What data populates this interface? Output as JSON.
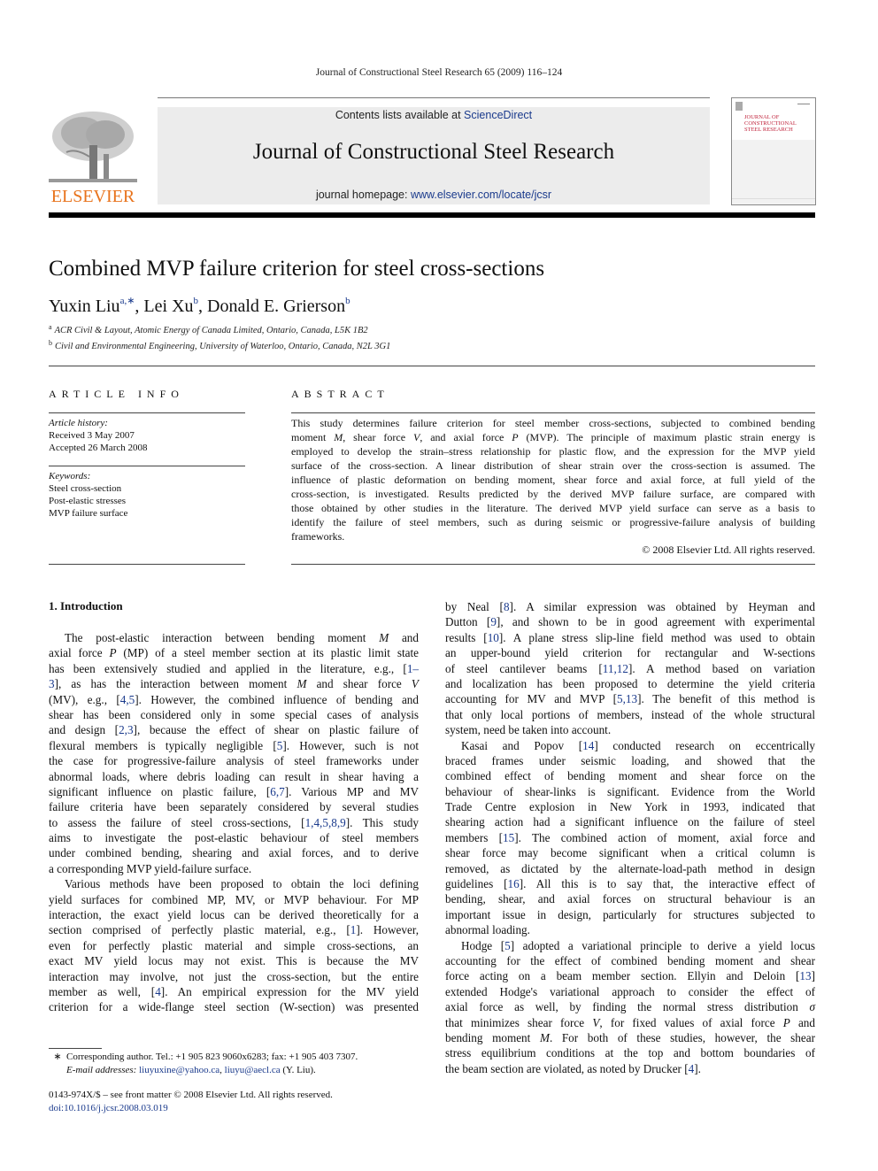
{
  "running_head": "Journal of Constructional Steel Research 65 (2009) 116–124",
  "banner": {
    "contents_prefix": "Contents lists available at ",
    "contents_link": "ScienceDirect",
    "journal_title": "Journal of Constructional Steel Research",
    "homepage_prefix": "journal homepage: ",
    "homepage_link": "www.elsevier.com/locate/jcsr"
  },
  "publisher_logo": "ELSEVIER",
  "cover": {
    "title_lines": [
      "JOURNAL OF",
      "CONSTRUCTIONAL",
      "STEEL RESEARCH"
    ]
  },
  "colors": {
    "link": "#1a3a8c",
    "elsevier_orange": "#e8731c",
    "cover_red": "#c0243c"
  },
  "article": {
    "title": "Combined MVP failure criterion for steel cross-sections",
    "authors": [
      {
        "name": "Yuxin Liu",
        "sup": "a,∗"
      },
      {
        "name": "Lei Xu",
        "sup": "b"
      },
      {
        "name": "Donald E. Grierson",
        "sup": "b"
      }
    ],
    "affiliations": [
      {
        "mark": "a",
        "text": "ACR Civil & Layout, Atomic Energy of Canada Limited, Ontario, Canada, L5K 1B2"
      },
      {
        "mark": "b",
        "text": "Civil and Environmental Engineering, University of Waterloo, Ontario, Canada, N2L 3G1"
      }
    ]
  },
  "article_info": {
    "heading": "ARTICLE INFO",
    "history_label": "Article history:",
    "received": "Received 3 May 2007",
    "accepted": "Accepted 26 March 2008",
    "keywords_label": "Keywords:",
    "keywords": [
      "Steel cross-section",
      "Post-elastic stresses",
      "MVP failure surface"
    ]
  },
  "abstract": {
    "heading": "ABSTRACT",
    "lines": [
      "This study determines failure criterion for steel member cross-sections, subjected to combined bending",
      "moment M, shear force V, and axial force P (MVP). The principle of maximum plastic strain energy is",
      "employed to develop the strain–stress relationship for plastic flow, and the expression for the MVP yield",
      "surface of the cross-section. A linear distribution of shear strain over the cross-section is assumed. The",
      "influence of plastic deformation on bending moment, shear force and axial force, at full yield of the",
      "cross-section, is investigated. Results predicted by the derived MVP failure surface, are compared with",
      "those obtained by other studies in the literature. The derived MVP yield surface can serve as a basis to",
      "identify the failure of steel members, such as during seismic or progressive-failure analysis of building",
      "frameworks."
    ],
    "copyright": "© 2008 Elsevier Ltd. All rights reserved."
  },
  "body": {
    "section_heading": "1.  Introduction",
    "left_lines": [
      "The post-elastic interaction between bending moment M and",
      "axial force P (MP) of a steel member section at its plastic limit state",
      "has been extensively studied and applied in the literature, e.g., [1–",
      "3], as has the interaction between moment M and shear force V",
      "(MV), e.g., [4,5]. However, the combined influence of bending and",
      "shear has been considered only in some special cases of analysis",
      "and design [2,3], because the effect of shear on plastic failure of",
      "flexural members is typically negligible [5]. However, such is not",
      "the case for progressive-failure analysis of steel frameworks under",
      "abnormal loads, where debris loading can result in shear having a",
      "significant influence on plastic failure, [6,7]. Various MP and MV",
      "failure criteria have been separately considered by several studies",
      "to assess the failure of steel cross-sections, [1,4,5,8,9]. This study",
      "aims to investigate the post-elastic behaviour of steel members",
      "under combined bending, shearing and axial forces, and to derive",
      "a corresponding MVP yield-failure surface.",
      "Various methods have been proposed to obtain the loci defining",
      "yield surfaces for combined MP, MV, or MVP behaviour. For MP",
      "interaction, the exact yield locus can be derived theoretically for a",
      "section comprised of perfectly plastic material, e.g., [1]. However,",
      "even for perfectly plastic material and simple cross-sections, an",
      "exact MV yield locus may not exist. This is because the MV",
      "interaction may involve, not just the cross-section, but the entire",
      "member as well, [4]. An empirical expression for the MV yield",
      "criterion for a wide-flange steel section (W-section) was presented"
    ],
    "right_lines": [
      "by Neal [8]. A similar expression was obtained by Heyman and",
      "Dutton [9], and shown to be in good agreement with experimental",
      "results [10]. A plane stress slip-line field method was used to obtain",
      "an upper-bound yield criterion for rectangular and W-sections",
      "of steel cantilever beams [11,12]. A method based on variation",
      "and localization has been proposed to determine the yield criteria",
      "accounting for MV and MVP [5,13]. The benefit of this method is",
      "that only local portions of members, instead of the whole structural",
      "system, need be taken into account.",
      "Kasai and Popov [14] conducted research on eccentrically",
      "braced frames under seismic loading, and showed that the",
      "combined effect of bending moment and shear force on the",
      "behaviour of shear-links is significant. Evidence from the World",
      "Trade Centre explosion in New York in 1993, indicated that",
      "shearing action had a significant influence on the failure of steel",
      "members [15]. The combined action of moment, axial force and",
      "shear force may become significant when a critical column is",
      "removed, as dictated by the alternate-load-path method in design",
      "guidelines [16]. All this is to say that, the interactive effect of",
      "bending, shear, and axial forces on structural behaviour is an",
      "important issue in design, particularly for structures subjected to",
      "abnormal loading.",
      "Hodge [5] adopted a variational principle to derive a yield locus",
      "accounting for the effect of combined bending moment and shear",
      "force acting on a beam member section. Ellyin and Deloin [13]",
      "extended Hodge's variational approach to consider the effect of",
      "axial force as well, by finding the normal stress distribution σ",
      "that minimizes shear force V, for fixed values of axial force P and",
      "bending moment M. For both of these studies, however, the shear",
      "stress equilibrium conditions at the top and bottom boundaries of",
      "the beam section are violated, as noted by Drucker [4]."
    ]
  },
  "footnote": {
    "star": "∗",
    "text": "Corresponding author. Tel.: +1 905 823 9060x6283; fax: +1 905 403 7307.",
    "email_label": "E-mail addresses:",
    "email1": "liuyuxine@yahoo.ca",
    "email2": "liuyu@aecl.ca",
    "email_suffix": " (Y. Liu)."
  },
  "front_matter": {
    "issn_line": "0143-974X/$ – see front matter © 2008 Elsevier Ltd. All rights reserved.",
    "doi": "doi:10.1016/j.jcsr.2008.03.019"
  }
}
